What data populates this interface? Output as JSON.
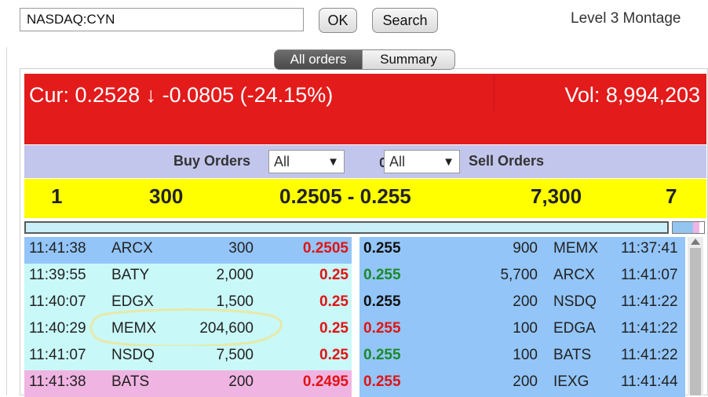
{
  "ticker_input": "NASDAQ:CYN",
  "ok_label": "OK",
  "search_label": "Search",
  "title": "Level 3 Montage",
  "tabs": [
    "All orders",
    "Summary"
  ],
  "quote": {
    "cur": "Cur: 0.2528 ↓ -0.0805 (-24.15%)",
    "vol": "Vol: 8,994,203"
  },
  "filters": {
    "buy_label": "Buy Orders",
    "sell_label": "Sell Orders",
    "buy_select": "All",
    "sell_select": "All"
  },
  "summary": {
    "bid_count": "1",
    "bid_size": "300",
    "spread": "0.2505 - 0.255",
    "ask_size": "7,300",
    "ask_count": "7"
  },
  "bid_rows": [
    {
      "time": "11:41:38",
      "mm": "ARCX",
      "size": "300",
      "price": "0.2505"
    },
    {
      "time": "11:39:55",
      "mm": "BATY",
      "size": "2,000",
      "price": "0.25"
    },
    {
      "time": "11:40:07",
      "mm": "EDGX",
      "size": "1,500",
      "price": "0.25"
    },
    {
      "time": "11:40:29",
      "mm": "MEMX",
      "size": "204,600",
      "price": "0.25"
    },
    {
      "time": "11:41:07",
      "mm": "NSDQ",
      "size": "7,500",
      "price": "0.25"
    },
    {
      "time": "11:41:38",
      "mm": "BATS",
      "size": "200",
      "price": "0.2495"
    }
  ],
  "ask_rows": [
    {
      "price": "0.255",
      "size": "900",
      "mm": "MEMX",
      "time": "11:37:41"
    },
    {
      "price": "0.255",
      "size": "5,700",
      "mm": "ARCX",
      "time": "11:41:07"
    },
    {
      "price": "0.255",
      "size": "200",
      "mm": "NSDQ",
      "time": "11:41:22"
    },
    {
      "price": "0.255",
      "size": "100",
      "mm": "EDGA",
      "time": "11:41:22"
    },
    {
      "price": "0.255",
      "size": "100",
      "mm": "BATS",
      "time": "11:41:22"
    },
    {
      "price": "0.255",
      "size": "200",
      "mm": "IEXG",
      "time": "11:41:44"
    }
  ],
  "colors": {
    "quote_bg": "#e31b1b",
    "filter_bg": "#c3c6ec",
    "summary_bg": "#ffff00",
    "bid_row_bgs": [
      "#93c5f9",
      "#c9f8f8",
      "#c9f8f8",
      "#c9f8f8",
      "#c9f8f8",
      "#f0b4e2"
    ],
    "ask_row_bg": "#93c5f9",
    "ask_price_colors": [
      "#111111",
      "#1b8a2b",
      "#111111",
      "#e01414",
      "#1b8a2b",
      "#e01414"
    ],
    "bid_price_color": "#e01414",
    "highlight_circle": "#e7e9a8"
  },
  "icons": {
    "filter_link": "link-icon",
    "scroll_up": "arrow-up-icon"
  }
}
